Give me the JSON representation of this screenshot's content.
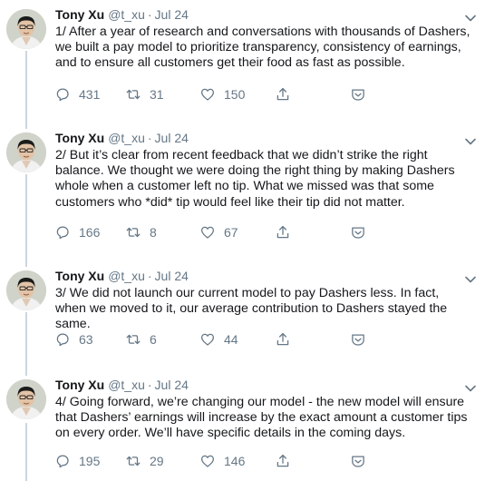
{
  "tweets": [
    {
      "name": "Tony Xu",
      "handle": "@t_xu",
      "separator": "·",
      "date": "Jul 24",
      "text": "1/ After a year of research and conversations with thousands of Dashers, we built a pay model to prioritize transparency, consistency of earnings, and to ensure all customers get their food as fast as possible.",
      "replies": "431",
      "retweets": "31",
      "likes": "150"
    },
    {
      "name": "Tony Xu",
      "handle": "@t_xu",
      "separator": "·",
      "date": "Jul 24",
      "text": "2/ But it’s clear from recent feedback that we didn’t strike the right balance. We thought we were doing the right thing by making Dashers whole when a customer left no tip. What we missed was that some customers who *did* tip would feel like their tip did not matter.",
      "replies": "166",
      "retweets": "8",
      "likes": "67"
    },
    {
      "name": "Tony Xu",
      "handle": "@t_xu",
      "separator": "·",
      "date": "Jul 24",
      "text": "3/ We did not launch our current model to pay Dashers less. In fact, when we moved to it, our average contribution to Dashers stayed the same.",
      "replies": "63",
      "retweets": "6",
      "likes": "44"
    },
    {
      "name": "Tony Xu",
      "handle": "@t_xu",
      "separator": "·",
      "date": "Jul 24",
      "text": "4/ Going forward, we’re changing our model - the new model will ensure that Dashers’ earnings will increase by the exact amount a customer tips on every order. We’ll have specific details in the coming days.",
      "replies": "195",
      "retweets": "29",
      "likes": "146"
    }
  ],
  "icons": {
    "reply": "reply-icon",
    "retweet": "retweet-icon",
    "like": "heart-icon",
    "share": "share-icon",
    "messages": "direct-message-icon",
    "menu": "chevron-down-icon"
  },
  "colors": {
    "text": "#14171a",
    "secondary": "#657786",
    "icon": "#657786",
    "thread_line": "#ccd6dd",
    "background": "#ffffff"
  }
}
